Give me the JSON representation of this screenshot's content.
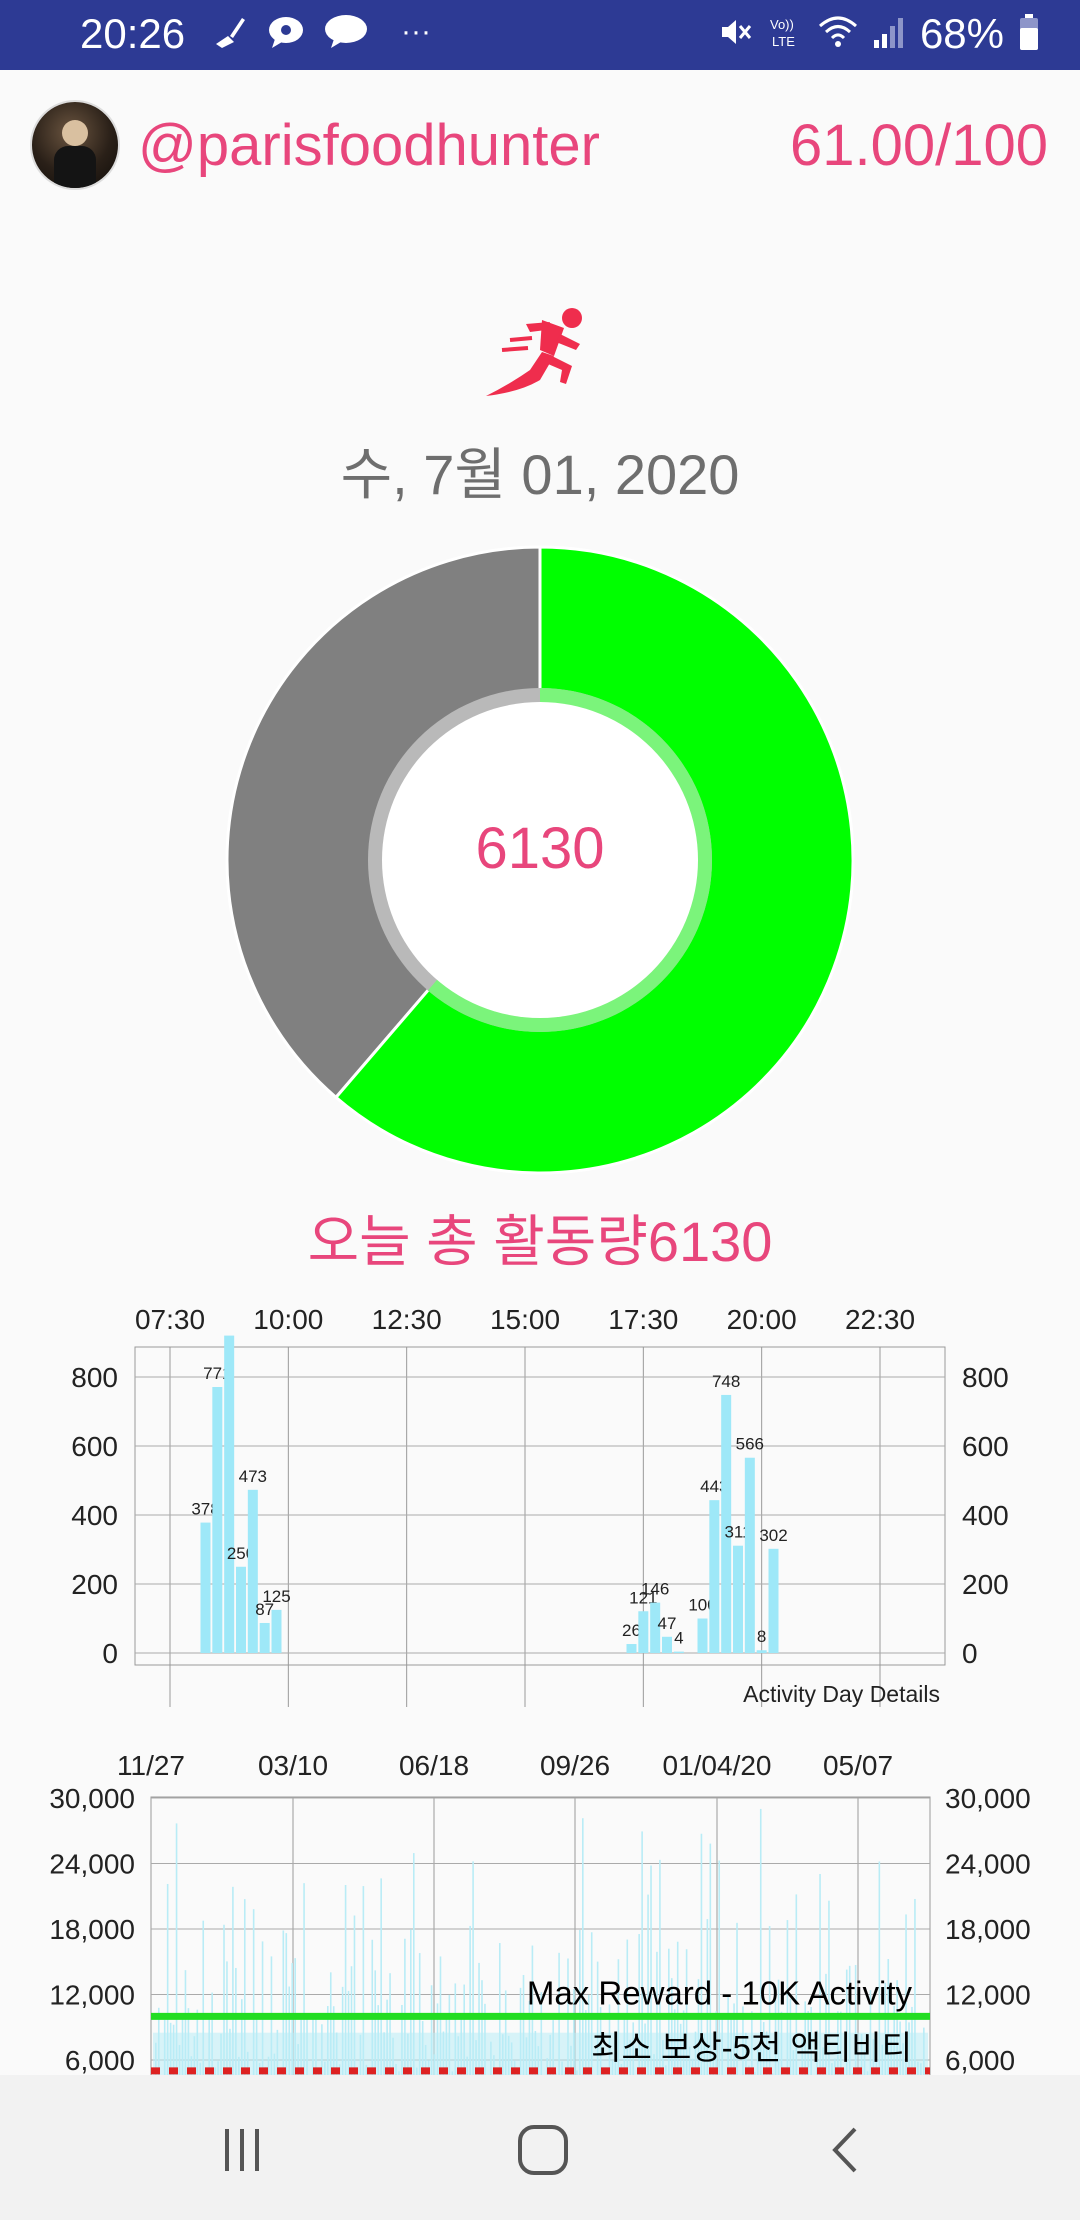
{
  "status_bar": {
    "time": "20:26",
    "icons_left": [
      "sweep-icon",
      "chat-bubble-icon",
      "talk-icon",
      "more-dots-icon"
    ],
    "talk_label": "TALK",
    "more": "···",
    "volte_label": "Vo)) LTE",
    "battery_text": "68%"
  },
  "header": {
    "username": "@parisfoodhunter",
    "score": "61.00/100"
  },
  "date": "수, 7월 01, 2020",
  "donut": {
    "center_value": "6130",
    "progress_fraction": 0.613,
    "colors": {
      "progress": "#00ff00",
      "remaining": "#808080",
      "ring_inner": "#7bf47b"
    }
  },
  "activity_title": "오늘 총 활동량6130",
  "chart_data": [
    {
      "type": "bar",
      "title": "",
      "annotation": "Activity Day Details",
      "x_tick_labels": [
        "07:30",
        "10:00",
        "12:30",
        "15:00",
        "17:30",
        "20:00",
        "22:30"
      ],
      "y_tick_labels": [
        "0",
        "200",
        "400",
        "600",
        "800"
      ],
      "ylim": [
        0,
        920
      ],
      "grid": true,
      "bar_color": "#9ee8f8",
      "series": [
        {
          "values": [
            {
              "x": "08:15",
              "y": 378,
              "label": "378"
            },
            {
              "x": "08:30",
              "y": 771,
              "label": "771"
            },
            {
              "x": "08:45",
              "y": 920,
              "label": ""
            },
            {
              "x": "09:00",
              "y": 250,
              "label": "250"
            },
            {
              "x": "09:15",
              "y": 473,
              "label": "473"
            },
            {
              "x": "09:30",
              "y": 87,
              "label": "87"
            },
            {
              "x": "09:45",
              "y": 125,
              "label": "125"
            },
            {
              "x": "17:15",
              "y": 26,
              "label": "26"
            },
            {
              "x": "17:30",
              "y": 121,
              "label": "121"
            },
            {
              "x": "17:45",
              "y": 146,
              "label": "146"
            },
            {
              "x": "18:00",
              "y": 47,
              "label": "47"
            },
            {
              "x": "18:15",
              "y": 4,
              "label": "4"
            },
            {
              "x": "18:45",
              "y": 100,
              "label": "100"
            },
            {
              "x": "19:00",
              "y": 443,
              "label": "443"
            },
            {
              "x": "19:15",
              "y": 748,
              "label": "748"
            },
            {
              "x": "19:30",
              "y": 311,
              "label": "311"
            },
            {
              "x": "19:45",
              "y": 566,
              "label": "566"
            },
            {
              "x": "20:00",
              "y": 8,
              "label": "8"
            },
            {
              "x": "20:15",
              "y": 302,
              "label": "302"
            }
          ]
        }
      ]
    },
    {
      "type": "bar",
      "title": "",
      "x_tick_labels": [
        "11/27",
        "03/10",
        "06/18",
        "09/26",
        "01/04/20",
        "05/07"
      ],
      "y_tick_labels": [
        "6,000",
        "12,000",
        "18,000",
        "24,000",
        "30,000"
      ],
      "ylim": [
        4500,
        30000
      ],
      "grid": true,
      "bar_color": "#b9ecf6",
      "reference_lines": [
        {
          "label": "Max Reward - 10K Activity",
          "y": 10000,
          "color": "#22dd22",
          "style": "solid"
        },
        {
          "label": "최소 보상-5천 액티비티",
          "y": 5000,
          "color": "#dd2222",
          "style": "dotted"
        }
      ],
      "series": [
        {
          "values_sample": [
            9000,
            12000,
            7000,
            15000,
            27500,
            11000,
            18000,
            24000,
            8000,
            13000,
            21000,
            10000,
            6500,
            16000,
            12500,
            9000,
            19000,
            7500,
            11000,
            14500
          ]
        }
      ]
    }
  ],
  "nav": {
    "recent_icon": "recent-apps-icon",
    "home_icon": "home-icon",
    "back_icon": "back-icon"
  }
}
